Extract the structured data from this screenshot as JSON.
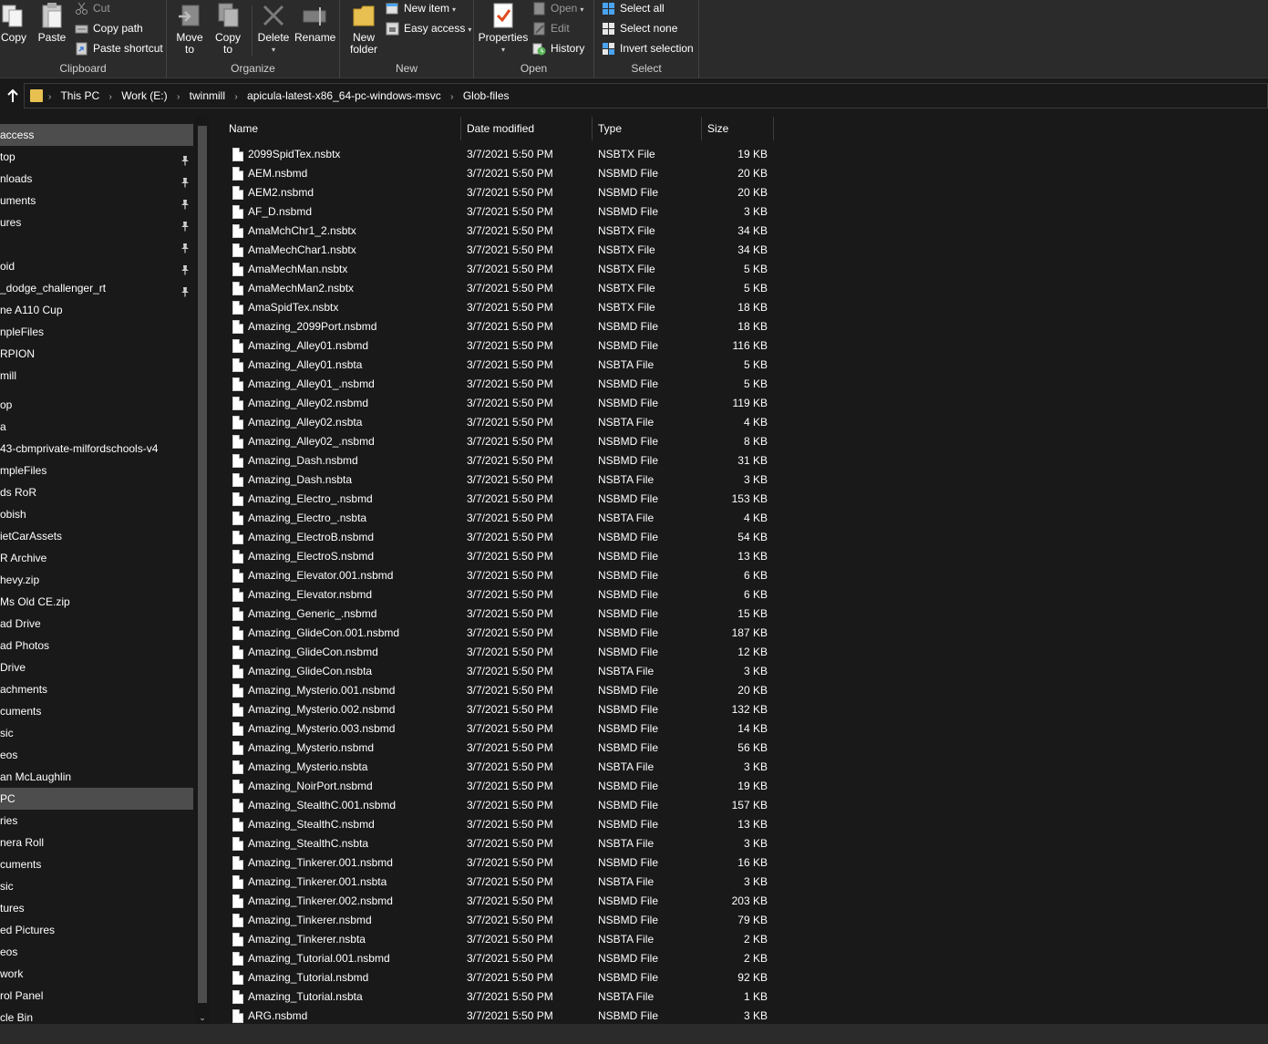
{
  "ribbon": {
    "clipboard": {
      "label": "Clipboard",
      "copy": "Copy",
      "paste": "Paste",
      "cut": "Cut",
      "copy_path": "Copy path",
      "paste_shortcut": "Paste shortcut"
    },
    "organize": {
      "label": "Organize",
      "move_to": "Move\nto",
      "copy_to": "Copy\nto",
      "delete": "Delete",
      "rename": "Rename"
    },
    "new": {
      "label": "New",
      "new_folder": "New\nfolder",
      "new_item": "New item",
      "easy_access": "Easy access"
    },
    "open": {
      "label": "Open",
      "properties": "Properties",
      "open": "Open",
      "edit": "Edit",
      "history": "History"
    },
    "select": {
      "label": "Select",
      "select_all": "Select all",
      "select_none": "Select none",
      "invert_selection": "Invert selection"
    }
  },
  "address": {
    "crumbs": [
      "This PC",
      "Work (E:)",
      "twinmill",
      "apicula-latest-x86_64-pc-windows-msvc",
      "Glob-files"
    ]
  },
  "nav": {
    "items": [
      {
        "label": "access",
        "selected": true,
        "pinned": false
      },
      {
        "label": "top",
        "selected": false,
        "pinned": true
      },
      {
        "label": "nloads",
        "selected": false,
        "pinned": true
      },
      {
        "label": "uments",
        "selected": false,
        "pinned": true
      },
      {
        "label": "ures",
        "selected": false,
        "pinned": true
      },
      {
        "label": "",
        "selected": false,
        "pinned": true
      },
      {
        "label": "oid",
        "selected": false,
        "pinned": true
      },
      {
        "label": "_dodge_challenger_rt",
        "selected": false,
        "pinned": true
      },
      {
        "label": "ne A110 Cup",
        "selected": false,
        "pinned": false
      },
      {
        "label": "npleFiles",
        "selected": false,
        "pinned": false
      },
      {
        "label": "RPION",
        "selected": false,
        "pinned": false
      },
      {
        "label": "mill",
        "selected": false,
        "pinned": false
      },
      {
        "label": "",
        "selected": false,
        "pinned": false,
        "gap": true
      },
      {
        "label": "op",
        "selected": false,
        "pinned": false
      },
      {
        "label": "a",
        "selected": false,
        "pinned": false
      },
      {
        "label": "43-cbmprivate-milfordschools-v4",
        "selected": false,
        "pinned": false
      },
      {
        "label": "mpleFiles",
        "selected": false,
        "pinned": false
      },
      {
        "label": "ds RoR",
        "selected": false,
        "pinned": false
      },
      {
        "label": "obish",
        "selected": false,
        "pinned": false
      },
      {
        "label": "ietCarAssets",
        "selected": false,
        "pinned": false
      },
      {
        "label": "R Archive",
        "selected": false,
        "pinned": false
      },
      {
        "label": "hevy.zip",
        "selected": false,
        "pinned": false
      },
      {
        "label": "Ms Old CE.zip",
        "selected": false,
        "pinned": false
      },
      {
        "label": "ad Drive",
        "selected": false,
        "pinned": false
      },
      {
        "label": "ad Photos",
        "selected": false,
        "pinned": false
      },
      {
        "label": "Drive",
        "selected": false,
        "pinned": false
      },
      {
        "label": "achments",
        "selected": false,
        "pinned": false
      },
      {
        "label": "cuments",
        "selected": false,
        "pinned": false
      },
      {
        "label": "sic",
        "selected": false,
        "pinned": false
      },
      {
        "label": "eos",
        "selected": false,
        "pinned": false
      },
      {
        "label": "an McLaughlin",
        "selected": false,
        "pinned": false
      },
      {
        "label": "PC",
        "selected": true,
        "pinned": false
      },
      {
        "label": "ries",
        "selected": false,
        "pinned": false
      },
      {
        "label": "nera Roll",
        "selected": false,
        "pinned": false
      },
      {
        "label": "cuments",
        "selected": false,
        "pinned": false
      },
      {
        "label": "sic",
        "selected": false,
        "pinned": false
      },
      {
        "label": "tures",
        "selected": false,
        "pinned": false
      },
      {
        "label": "ed Pictures",
        "selected": false,
        "pinned": false
      },
      {
        "label": "eos",
        "selected": false,
        "pinned": false
      },
      {
        "label": "work",
        "selected": false,
        "pinned": false
      },
      {
        "label": "rol Panel",
        "selected": false,
        "pinned": false
      },
      {
        "label": "cle Bin",
        "selected": false,
        "pinned": false
      }
    ]
  },
  "columns": {
    "name": "Name",
    "date": "Date modified",
    "type": "Type",
    "size": "Size"
  },
  "files": [
    {
      "name": "2099SpidTex.nsbtx",
      "date": "3/7/2021 5:50 PM",
      "type": "NSBTX File",
      "size": "19 KB"
    },
    {
      "name": "AEM.nsbmd",
      "date": "3/7/2021 5:50 PM",
      "type": "NSBMD File",
      "size": "20 KB"
    },
    {
      "name": "AEM2.nsbmd",
      "date": "3/7/2021 5:50 PM",
      "type": "NSBMD File",
      "size": "20 KB"
    },
    {
      "name": "AF_D.nsbmd",
      "date": "3/7/2021 5:50 PM",
      "type": "NSBMD File",
      "size": "3 KB"
    },
    {
      "name": "AmaMchChr1_2.nsbtx",
      "date": "3/7/2021 5:50 PM",
      "type": "NSBTX File",
      "size": "34 KB"
    },
    {
      "name": "AmaMechChar1.nsbtx",
      "date": "3/7/2021 5:50 PM",
      "type": "NSBTX File",
      "size": "34 KB"
    },
    {
      "name": "AmaMechMan.nsbtx",
      "date": "3/7/2021 5:50 PM",
      "type": "NSBTX File",
      "size": "5 KB"
    },
    {
      "name": "AmaMechMan2.nsbtx",
      "date": "3/7/2021 5:50 PM",
      "type": "NSBTX File",
      "size": "5 KB"
    },
    {
      "name": "AmaSpidTex.nsbtx",
      "date": "3/7/2021 5:50 PM",
      "type": "NSBTX File",
      "size": "18 KB"
    },
    {
      "name": "Amazing_2099Port.nsbmd",
      "date": "3/7/2021 5:50 PM",
      "type": "NSBMD File",
      "size": "18 KB"
    },
    {
      "name": "Amazing_Alley01.nsbmd",
      "date": "3/7/2021 5:50 PM",
      "type": "NSBMD File",
      "size": "116 KB"
    },
    {
      "name": "Amazing_Alley01.nsbta",
      "date": "3/7/2021 5:50 PM",
      "type": "NSBTA File",
      "size": "5 KB"
    },
    {
      "name": "Amazing_Alley01_.nsbmd",
      "date": "3/7/2021 5:50 PM",
      "type": "NSBMD File",
      "size": "5 KB"
    },
    {
      "name": "Amazing_Alley02.nsbmd",
      "date": "3/7/2021 5:50 PM",
      "type": "NSBMD File",
      "size": "119 KB"
    },
    {
      "name": "Amazing_Alley02.nsbta",
      "date": "3/7/2021 5:50 PM",
      "type": "NSBTA File",
      "size": "4 KB"
    },
    {
      "name": "Amazing_Alley02_.nsbmd",
      "date": "3/7/2021 5:50 PM",
      "type": "NSBMD File",
      "size": "8 KB"
    },
    {
      "name": "Amazing_Dash.nsbmd",
      "date": "3/7/2021 5:50 PM",
      "type": "NSBMD File",
      "size": "31 KB"
    },
    {
      "name": "Amazing_Dash.nsbta",
      "date": "3/7/2021 5:50 PM",
      "type": "NSBTA File",
      "size": "3 KB"
    },
    {
      "name": "Amazing_Electro_.nsbmd",
      "date": "3/7/2021 5:50 PM",
      "type": "NSBMD File",
      "size": "153 KB"
    },
    {
      "name": "Amazing_Electro_.nsbta",
      "date": "3/7/2021 5:50 PM",
      "type": "NSBTA File",
      "size": "4 KB"
    },
    {
      "name": "Amazing_ElectroB.nsbmd",
      "date": "3/7/2021 5:50 PM",
      "type": "NSBMD File",
      "size": "54 KB"
    },
    {
      "name": "Amazing_ElectroS.nsbmd",
      "date": "3/7/2021 5:50 PM",
      "type": "NSBMD File",
      "size": "13 KB"
    },
    {
      "name": "Amazing_Elevator.001.nsbmd",
      "date": "3/7/2021 5:50 PM",
      "type": "NSBMD File",
      "size": "6 KB"
    },
    {
      "name": "Amazing_Elevator.nsbmd",
      "date": "3/7/2021 5:50 PM",
      "type": "NSBMD File",
      "size": "6 KB"
    },
    {
      "name": "Amazing_Generic_.nsbmd",
      "date": "3/7/2021 5:50 PM",
      "type": "NSBMD File",
      "size": "15 KB"
    },
    {
      "name": "Amazing_GlideCon.001.nsbmd",
      "date": "3/7/2021 5:50 PM",
      "type": "NSBMD File",
      "size": "187 KB"
    },
    {
      "name": "Amazing_GlideCon.nsbmd",
      "date": "3/7/2021 5:50 PM",
      "type": "NSBMD File",
      "size": "12 KB"
    },
    {
      "name": "Amazing_GlideCon.nsbta",
      "date": "3/7/2021 5:50 PM",
      "type": "NSBTA File",
      "size": "3 KB"
    },
    {
      "name": "Amazing_Mysterio.001.nsbmd",
      "date": "3/7/2021 5:50 PM",
      "type": "NSBMD File",
      "size": "20 KB"
    },
    {
      "name": "Amazing_Mysterio.002.nsbmd",
      "date": "3/7/2021 5:50 PM",
      "type": "NSBMD File",
      "size": "132 KB"
    },
    {
      "name": "Amazing_Mysterio.003.nsbmd",
      "date": "3/7/2021 5:50 PM",
      "type": "NSBMD File",
      "size": "14 KB"
    },
    {
      "name": "Amazing_Mysterio.nsbmd",
      "date": "3/7/2021 5:50 PM",
      "type": "NSBMD File",
      "size": "56 KB"
    },
    {
      "name": "Amazing_Mysterio.nsbta",
      "date": "3/7/2021 5:50 PM",
      "type": "NSBTA File",
      "size": "3 KB"
    },
    {
      "name": "Amazing_NoirPort.nsbmd",
      "date": "3/7/2021 5:50 PM",
      "type": "NSBMD File",
      "size": "19 KB"
    },
    {
      "name": "Amazing_StealthC.001.nsbmd",
      "date": "3/7/2021 5:50 PM",
      "type": "NSBMD File",
      "size": "157 KB"
    },
    {
      "name": "Amazing_StealthC.nsbmd",
      "date": "3/7/2021 5:50 PM",
      "type": "NSBMD File",
      "size": "13 KB"
    },
    {
      "name": "Amazing_StealthC.nsbta",
      "date": "3/7/2021 5:50 PM",
      "type": "NSBTA File",
      "size": "3 KB"
    },
    {
      "name": "Amazing_Tinkerer.001.nsbmd",
      "date": "3/7/2021 5:50 PM",
      "type": "NSBMD File",
      "size": "16 KB"
    },
    {
      "name": "Amazing_Tinkerer.001.nsbta",
      "date": "3/7/2021 5:50 PM",
      "type": "NSBTA File",
      "size": "3 KB"
    },
    {
      "name": "Amazing_Tinkerer.002.nsbmd",
      "date": "3/7/2021 5:50 PM",
      "type": "NSBMD File",
      "size": "203 KB"
    },
    {
      "name": "Amazing_Tinkerer.nsbmd",
      "date": "3/7/2021 5:50 PM",
      "type": "NSBMD File",
      "size": "79 KB"
    },
    {
      "name": "Amazing_Tinkerer.nsbta",
      "date": "3/7/2021 5:50 PM",
      "type": "NSBTA File",
      "size": "2 KB"
    },
    {
      "name": "Amazing_Tutorial.001.nsbmd",
      "date": "3/7/2021 5:50 PM",
      "type": "NSBMD File",
      "size": "2 KB"
    },
    {
      "name": "Amazing_Tutorial.nsbmd",
      "date": "3/7/2021 5:50 PM",
      "type": "NSBMD File",
      "size": "92 KB"
    },
    {
      "name": "Amazing_Tutorial.nsbta",
      "date": "3/7/2021 5:50 PM",
      "type": "NSBTA File",
      "size": "1 KB"
    },
    {
      "name": "ARG.nsbmd",
      "date": "3/7/2021 5:50 PM",
      "type": "NSBMD File",
      "size": "3 KB"
    }
  ],
  "colors": {
    "background": "#191919",
    "ribbon": "#2b2b2b",
    "selection": "#4d4d4d",
    "folder": "#e8c051",
    "accent_blue": "#4aa3f0"
  }
}
